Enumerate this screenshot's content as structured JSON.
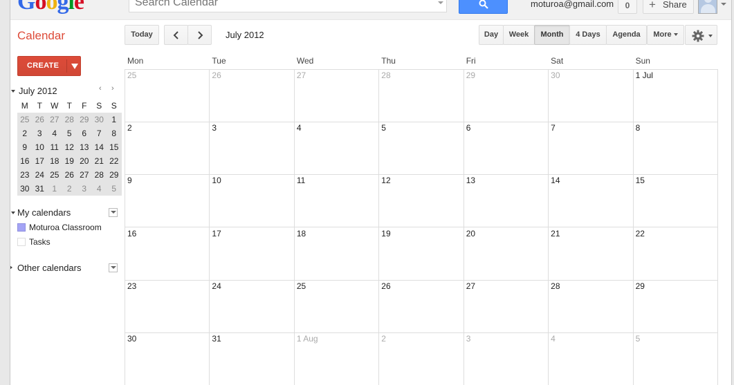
{
  "header": {
    "logo_letters": [
      "G",
      "o",
      "o",
      "g",
      "l",
      "e"
    ],
    "search_placeholder": "Search Calendar",
    "user_email": "moturoa@gmail.com",
    "notification_count": "0",
    "share_label": "Share",
    "share_plus": "+"
  },
  "toolbar": {
    "app_title": "Calendar",
    "today_label": "Today",
    "prev_label": "‹",
    "next_label": "›",
    "date_range": "July 2012",
    "views": [
      "Day",
      "Week",
      "Month",
      "4 Days",
      "Agenda"
    ],
    "active_view": "Month",
    "more_label": "More"
  },
  "sidebar": {
    "create_label": "CREATE",
    "mini_calendar": {
      "title": "July 2012",
      "prev_label": "‹",
      "next_label": "›",
      "weekdays": [
        "M",
        "T",
        "W",
        "T",
        "F",
        "S",
        "S"
      ],
      "weeks": [
        [
          {
            "d": "25",
            "dim": true
          },
          {
            "d": "26",
            "dim": true
          },
          {
            "d": "27",
            "dim": true
          },
          {
            "d": "28",
            "dim": true
          },
          {
            "d": "29",
            "dim": true
          },
          {
            "d": "30",
            "dim": true
          },
          {
            "d": "1",
            "dim": false
          }
        ],
        [
          {
            "d": "2",
            "dim": false
          },
          {
            "d": "3",
            "dim": false
          },
          {
            "d": "4",
            "dim": false
          },
          {
            "d": "5",
            "dim": false
          },
          {
            "d": "6",
            "dim": false
          },
          {
            "d": "7",
            "dim": false
          },
          {
            "d": "8",
            "dim": false
          }
        ],
        [
          {
            "d": "9",
            "dim": false
          },
          {
            "d": "10",
            "dim": false
          },
          {
            "d": "11",
            "dim": false
          },
          {
            "d": "12",
            "dim": false
          },
          {
            "d": "13",
            "dim": false
          },
          {
            "d": "14",
            "dim": false
          },
          {
            "d": "15",
            "dim": false
          }
        ],
        [
          {
            "d": "16",
            "dim": false
          },
          {
            "d": "17",
            "dim": false
          },
          {
            "d": "18",
            "dim": false
          },
          {
            "d": "19",
            "dim": false
          },
          {
            "d": "20",
            "dim": false
          },
          {
            "d": "21",
            "dim": false
          },
          {
            "d": "22",
            "dim": false
          }
        ],
        [
          {
            "d": "23",
            "dim": false
          },
          {
            "d": "24",
            "dim": false
          },
          {
            "d": "25",
            "dim": false
          },
          {
            "d": "26",
            "dim": false
          },
          {
            "d": "27",
            "dim": false
          },
          {
            "d": "28",
            "dim": false
          },
          {
            "d": "29",
            "dim": false
          }
        ],
        [
          {
            "d": "30",
            "dim": false
          },
          {
            "d": "31",
            "dim": false
          },
          {
            "d": "1",
            "dim": true
          },
          {
            "d": "2",
            "dim": true
          },
          {
            "d": "3",
            "dim": true
          },
          {
            "d": "4",
            "dim": true
          },
          {
            "d": "5",
            "dim": true
          }
        ]
      ]
    },
    "my_calendars": {
      "title": "My calendars",
      "items": [
        {
          "label": "Moturoa Classroom",
          "color": "#a4a4f5"
        },
        {
          "label": "Tasks",
          "color": "#ffffff"
        }
      ]
    },
    "other_calendars": {
      "title": "Other calendars"
    }
  },
  "month_view": {
    "weekdays": [
      "Mon",
      "Tue",
      "Wed",
      "Thu",
      "Fri",
      "Sat",
      "Sun"
    ],
    "weeks": [
      [
        {
          "d": "25",
          "dim": true
        },
        {
          "d": "26",
          "dim": true
        },
        {
          "d": "27",
          "dim": true
        },
        {
          "d": "28",
          "dim": true
        },
        {
          "d": "29",
          "dim": true
        },
        {
          "d": "30",
          "dim": true
        },
        {
          "d": "1 Jul",
          "dim": false
        }
      ],
      [
        {
          "d": "2",
          "dim": false
        },
        {
          "d": "3",
          "dim": false
        },
        {
          "d": "4",
          "dim": false
        },
        {
          "d": "5",
          "dim": false
        },
        {
          "d": "6",
          "dim": false
        },
        {
          "d": "7",
          "dim": false
        },
        {
          "d": "8",
          "dim": false
        }
      ],
      [
        {
          "d": "9",
          "dim": false
        },
        {
          "d": "10",
          "dim": false
        },
        {
          "d": "11",
          "dim": false
        },
        {
          "d": "12",
          "dim": false
        },
        {
          "d": "13",
          "dim": false
        },
        {
          "d": "14",
          "dim": false
        },
        {
          "d": "15",
          "dim": false
        }
      ],
      [
        {
          "d": "16",
          "dim": false
        },
        {
          "d": "17",
          "dim": false
        },
        {
          "d": "18",
          "dim": false
        },
        {
          "d": "19",
          "dim": false
        },
        {
          "d": "20",
          "dim": false
        },
        {
          "d": "21",
          "dim": false
        },
        {
          "d": "22",
          "dim": false
        }
      ],
      [
        {
          "d": "23",
          "dim": false
        },
        {
          "d": "24",
          "dim": false
        },
        {
          "d": "25",
          "dim": false
        },
        {
          "d": "26",
          "dim": false
        },
        {
          "d": "27",
          "dim": false
        },
        {
          "d": "28",
          "dim": false
        },
        {
          "d": "29",
          "dim": false
        }
      ],
      [
        {
          "d": "30",
          "dim": false
        },
        {
          "d": "31",
          "dim": false
        },
        {
          "d": "1 Aug",
          "dim": true
        },
        {
          "d": "2",
          "dim": true
        },
        {
          "d": "3",
          "dim": true
        },
        {
          "d": "4",
          "dim": true
        },
        {
          "d": "5",
          "dim": true
        }
      ]
    ]
  },
  "colors": {
    "brand_red": "#dd4b39",
    "search_blue": "#4d90fe",
    "grid_line": "#dddddd"
  }
}
